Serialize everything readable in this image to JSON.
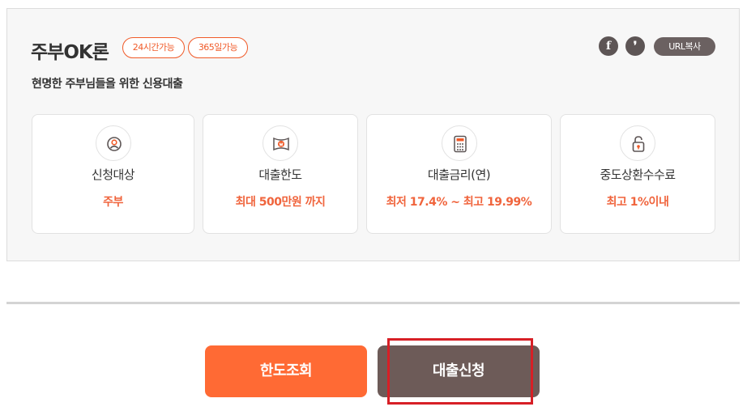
{
  "product": {
    "title": "주부OK론",
    "badges": [
      "24시간가능",
      "365일가능"
    ],
    "subtitle": "현명한 주부님들을 위한 신용대출"
  },
  "share": {
    "facebook_glyph": "f",
    "talk_glyph": "❜",
    "url_copy_label": "URL복사"
  },
  "cards": [
    {
      "icon": "person-icon",
      "label": "신청대상",
      "value": "주부"
    },
    {
      "icon": "money-icon",
      "label": "대출한도",
      "value": "최대 500만원 까지"
    },
    {
      "icon": "calculator-icon",
      "label": "대출금리(연)",
      "value": "최저 17.4% ~ 최고 19.99%"
    },
    {
      "icon": "lock-icon",
      "label": "중도상환수수료",
      "value": "최고 1%이내"
    }
  ],
  "actions": {
    "limit_check_label": "한도조회",
    "apply_label": "대출신청"
  },
  "colors": {
    "accent_orange": "#ff6a34",
    "value_text": "#f0643c",
    "apply_brown": "#6d5b58",
    "highlight_red": "#d71f26"
  }
}
